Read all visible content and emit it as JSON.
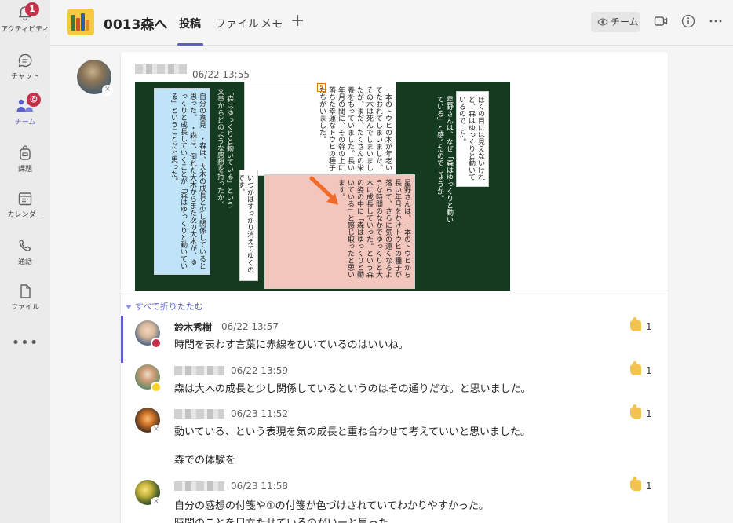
{
  "rail": {
    "items": [
      {
        "label": "アクティビティ",
        "icon": "bell-icon",
        "badge": "1"
      },
      {
        "label": "チャット",
        "icon": "chat-icon"
      },
      {
        "label": "チーム",
        "icon": "teams-icon",
        "badge": "@",
        "active": true
      },
      {
        "label": "課題",
        "icon": "backpack-icon"
      },
      {
        "label": "カレンダー",
        "icon": "calendar-icon"
      },
      {
        "label": "通話",
        "icon": "phone-icon"
      },
      {
        "label": "ファイル",
        "icon": "file-icon"
      }
    ],
    "more": "•••"
  },
  "header": {
    "channel_name": "0013森へ",
    "tabs": [
      {
        "label": "投稿",
        "active": true
      },
      {
        "label": "ファイル"
      },
      {
        "label": "メモ"
      }
    ],
    "add_tab": "+",
    "meet_button": "チーム",
    "icons": [
      "video-icon",
      "info-icon",
      "more-icon"
    ]
  },
  "post": {
    "time": "06/22 13:55",
    "collapse_label": "すべて折りたたむ",
    "attachment": {
      "board_question": "星野さんは、なぜ「森はゆっくりと動いている」と感じたのでしょうか。",
      "board_prompt": "「森はゆっくりと動いている」という文章からどのような感想を持ったか。",
      "board_tag": "5",
      "sticky_top_left": "一本のトウヒの木が年老いてたおれてしまいました。その木は死んでしまいましたが、まだ、たくさんの栄養をもっていました。長い年月の間に、その幹の上に落ちた幸運なトウヒの種子たちがいました。",
      "sticky_top_right": "ぼくの目には見えないけれど、森はゆっくりと動いているのでした。",
      "sticky_blue": "自分の意見　・森は、大木の成長と少し関係していると思った。　・森は、倒れた大木からまた次の大木が、ゆっくりと成長していくことが「森はゆっくりと動いている」ということだと思った。",
      "sticky_small": "いつかはすっかり消えてゆくのです。",
      "sticky_pink": "星野さんは、一本のトウヒから長い年月をかけトウヒの種子が落ちて、さらに気の遠くなるような時間のなかでゆっくりと大木に成長していった。という森の姿の中に「森はゆっくりと動いている」と感じ取ったと思います。"
    }
  },
  "replies": [
    {
      "name": "鈴木秀樹",
      "time": "06/22 13:57",
      "text": [
        "時間を表わす言葉に赤線をひいているのはいいね。"
      ],
      "likes": "1",
      "status": "busy",
      "name_visible": true
    },
    {
      "name": "",
      "time": "06/22 13:59",
      "text": [
        "森は大木の成長と少し関係しているというのはその通りだな。と思いました。"
      ],
      "likes": "1",
      "status": "away",
      "name_visible": false
    },
    {
      "name": "",
      "time": "06/23 11:52",
      "text": [
        "動いている、という表現を気の成長と重ね合わせて考えていいと思いました。",
        "森での体験を"
      ],
      "likes": "1",
      "status": "offline",
      "name_visible": false
    },
    {
      "name": "",
      "time": "06/23 11:58",
      "text": [
        "自分の感想の付箋や①の付箋が色づけされていてわかりやすかった。",
        "時間のことを目立たせているのがいーと思った。"
      ],
      "likes": "1",
      "status": "offline",
      "name_visible": false
    }
  ],
  "colors": {
    "accent": "#5b5fc7",
    "badge": "#c4314b",
    "board": "#143a1f"
  }
}
